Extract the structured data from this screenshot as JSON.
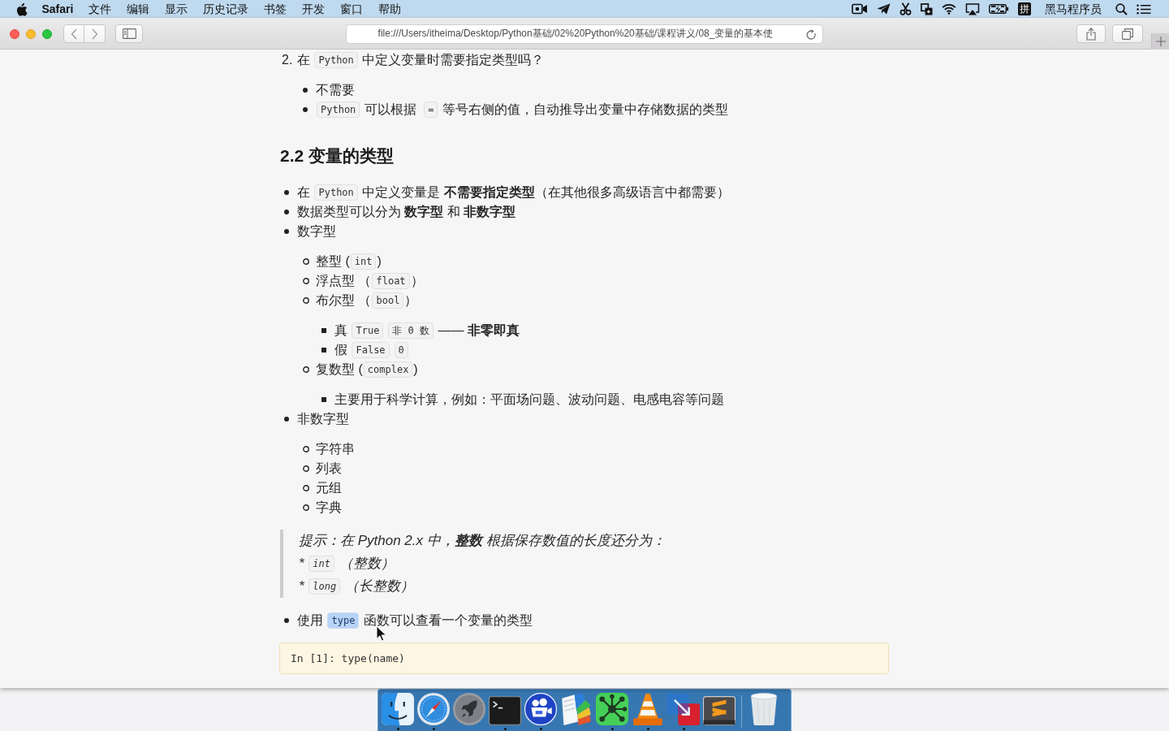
{
  "menu_bar": {
    "app": "Safari",
    "menus": [
      "文件",
      "编辑",
      "显示",
      "历史记录",
      "书签",
      "开发",
      "窗口",
      "帮助"
    ],
    "input_source": "拼",
    "user": "黑马程序员"
  },
  "toolbar": {
    "address": "file:///Users/itheima/Desktop/Python基础/02%20Python%20基础/课程讲义/08_变量的基本使"
  },
  "document": [
    {
      "kind": "ordered_item",
      "number": "2.",
      "parts": [
        {
          "kind": "text",
          "text": "在 "
        },
        {
          "kind": "code",
          "text": "Python"
        },
        {
          "kind": "text",
          "text": " 中定义变量时需要指定类型吗？"
        }
      ],
      "children": [
        {
          "parts": [
            {
              "kind": "text",
              "text": "不需要"
            }
          ]
        },
        {
          "parts": [
            {
              "kind": "code",
              "text": "Python"
            },
            {
              "kind": "text",
              "text": " 可以根据 "
            },
            {
              "kind": "code",
              "text": "="
            },
            {
              "kind": "text",
              "text": " 等号右侧的值，自动推导出变量中存储数据的类型"
            }
          ]
        }
      ]
    },
    {
      "kind": "heading",
      "text": "2.2 变量的类型"
    },
    {
      "kind": "list",
      "items": [
        {
          "parts": [
            {
              "kind": "text",
              "text": "在 "
            },
            {
              "kind": "code",
              "text": "Python"
            },
            {
              "kind": "text",
              "text": " 中定义变量是 **不需要指定类型**（在其他很多高级语言中都需要）"
            }
          ]
        },
        {
          "parts": [
            {
              "kind": "text",
              "text": "数据类型可以分为 **数字型** 和 **非数字型**"
            }
          ]
        },
        {
          "parts": [
            {
              "kind": "text",
              "text": "数字型"
            }
          ],
          "children": [
            {
              "parts": [
                {
                  "kind": "text",
                  "text": "整型 ("
                },
                {
                  "kind": "code",
                  "text": "int"
                },
                {
                  "kind": "text",
                  "text": ")"
                }
              ]
            },
            {
              "parts": [
                {
                  "kind": "text",
                  "text": "浮点型 （"
                },
                {
                  "kind": "code",
                  "text": "float"
                },
                {
                  "kind": "text",
                  "text": "）"
                }
              ]
            },
            {
              "parts": [
                {
                  "kind": "text",
                  "text": "布尔型 （"
                },
                {
                  "kind": "code",
                  "text": "bool"
                },
                {
                  "kind": "text",
                  "text": "）"
                }
              ],
              "children": [
                {
                  "parts": [
                    {
                      "kind": "text",
                      "text": "真 "
                    },
                    {
                      "kind": "code",
                      "text": "True"
                    },
                    {
                      "kind": "code",
                      "text": "非 0 数"
                    },
                    {
                      "kind": "text",
                      "text": " —— **非零即真**"
                    }
                  ]
                },
                {
                  "parts": [
                    {
                      "kind": "text",
                      "text": "假 "
                    },
                    {
                      "kind": "code",
                      "text": "False"
                    },
                    {
                      "kind": "code",
                      "text": "0"
                    }
                  ]
                }
              ]
            },
            {
              "parts": [
                {
                  "kind": "text",
                  "text": "复数型 ("
                },
                {
                  "kind": "code",
                  "text": "complex"
                },
                {
                  "kind": "text",
                  "text": ")"
                }
              ],
              "children": [
                {
                  "parts": [
                    {
                      "kind": "text",
                      "text": "主要用于科学计算，例如：平面场问题、波动问题、电感电容等问题"
                    }
                  ]
                }
              ]
            }
          ]
        },
        {
          "parts": [
            {
              "kind": "text",
              "text": "非数字型"
            }
          ],
          "children": [
            {
              "parts": [
                {
                  "kind": "text",
                  "text": "字符串"
                }
              ]
            },
            {
              "parts": [
                {
                  "kind": "text",
                  "text": "列表"
                }
              ]
            },
            {
              "parts": [
                {
                  "kind": "text",
                  "text": "元组"
                }
              ]
            },
            {
              "parts": [
                {
                  "kind": "text",
                  "text": "字典"
                }
              ]
            }
          ]
        }
      ]
    },
    {
      "kind": "quote",
      "lines": [
        {
          "parts": [
            {
              "kind": "text",
              "text": "提示：在 Python 2.x 中，**整数** 根据保存数值的长度还分为："
            }
          ]
        },
        {
          "parts": [
            {
              "kind": "text",
              "text": "* "
            },
            {
              "kind": "code",
              "text": "int"
            },
            {
              "kind": "text",
              "text": " （整数）"
            }
          ]
        },
        {
          "parts": [
            {
              "kind": "text",
              "text": "* "
            },
            {
              "kind": "code",
              "text": "long"
            },
            {
              "kind": "text",
              "text": " （长整数）"
            }
          ]
        }
      ]
    },
    {
      "kind": "list",
      "items": [
        {
          "parts": [
            {
              "kind": "text",
              "text": "使用 "
            },
            {
              "kind": "selected_code",
              "text": "type"
            },
            {
              "kind": "text",
              "text": " 函数可以查看一个变量的类型"
            }
          ]
        }
      ]
    },
    {
      "kind": "code_block",
      "text": "In [1]: type(name)"
    }
  ],
  "dock": {
    "items": [
      {
        "kind": "face",
        "running": true
      },
      {
        "kind": "compass",
        "running": true
      },
      {
        "kind": "rocket",
        "running": false
      },
      {
        "kind": "terminal",
        "running": true
      },
      {
        "kind": "camera",
        "running": true
      },
      {
        "kind": "book",
        "running": false
      },
      {
        "kind": "graph",
        "running": true
      },
      {
        "kind": "cone",
        "running": true
      },
      {
        "kind": "squares",
        "running": true
      },
      {
        "kind": "slabs",
        "running": false
      },
      {
        "kind": "trash",
        "running": false
      }
    ]
  }
}
